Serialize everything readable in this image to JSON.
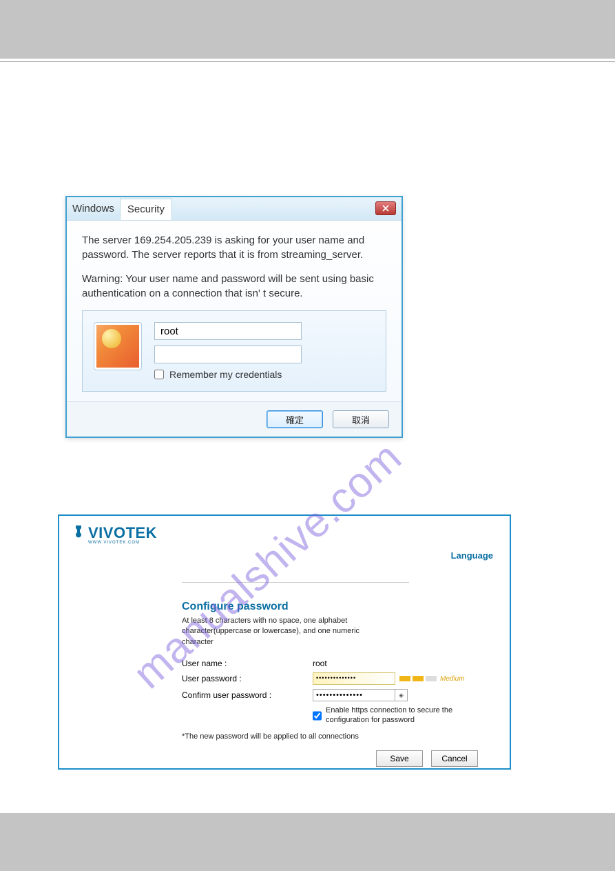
{
  "watermark": "manualshive.com",
  "win": {
    "title1": "Windows",
    "title2": "Security",
    "msg1": "The server 169.254.205.239 is asking for your user name and password. The server reports that it is from streaming_server.",
    "msg2": "Warning: Your user name and password will be sent using basic authentication on a connection that isn'  t secure.",
    "username": "root",
    "password": "",
    "remember_label": "Remember my credentials",
    "ok_label": "確定",
    "cancel_label": "取消"
  },
  "viv": {
    "brand": "VIVOTEK",
    "brand_sub": "WWW.VIVOTEK.COM",
    "language_link": "Language",
    "heading": "Configure password",
    "desc": "At least 8 characters with no space, one alphabet character(uppercase or lowercase), and one numeric character",
    "labels": {
      "username": "User name :",
      "user_password": "User password :",
      "confirm_password": "Confirm user password :"
    },
    "values": {
      "username": "root",
      "user_password_mask": "••••••••••••••",
      "confirm_password_mask": "••••••••••••••"
    },
    "strength_label": "Medium",
    "https_checked": true,
    "https_label": "Enable https connection to secure the configuration for password",
    "note": "*The new password will be applied to all connections",
    "save_label": "Save",
    "cancel_label": "Cancel"
  }
}
